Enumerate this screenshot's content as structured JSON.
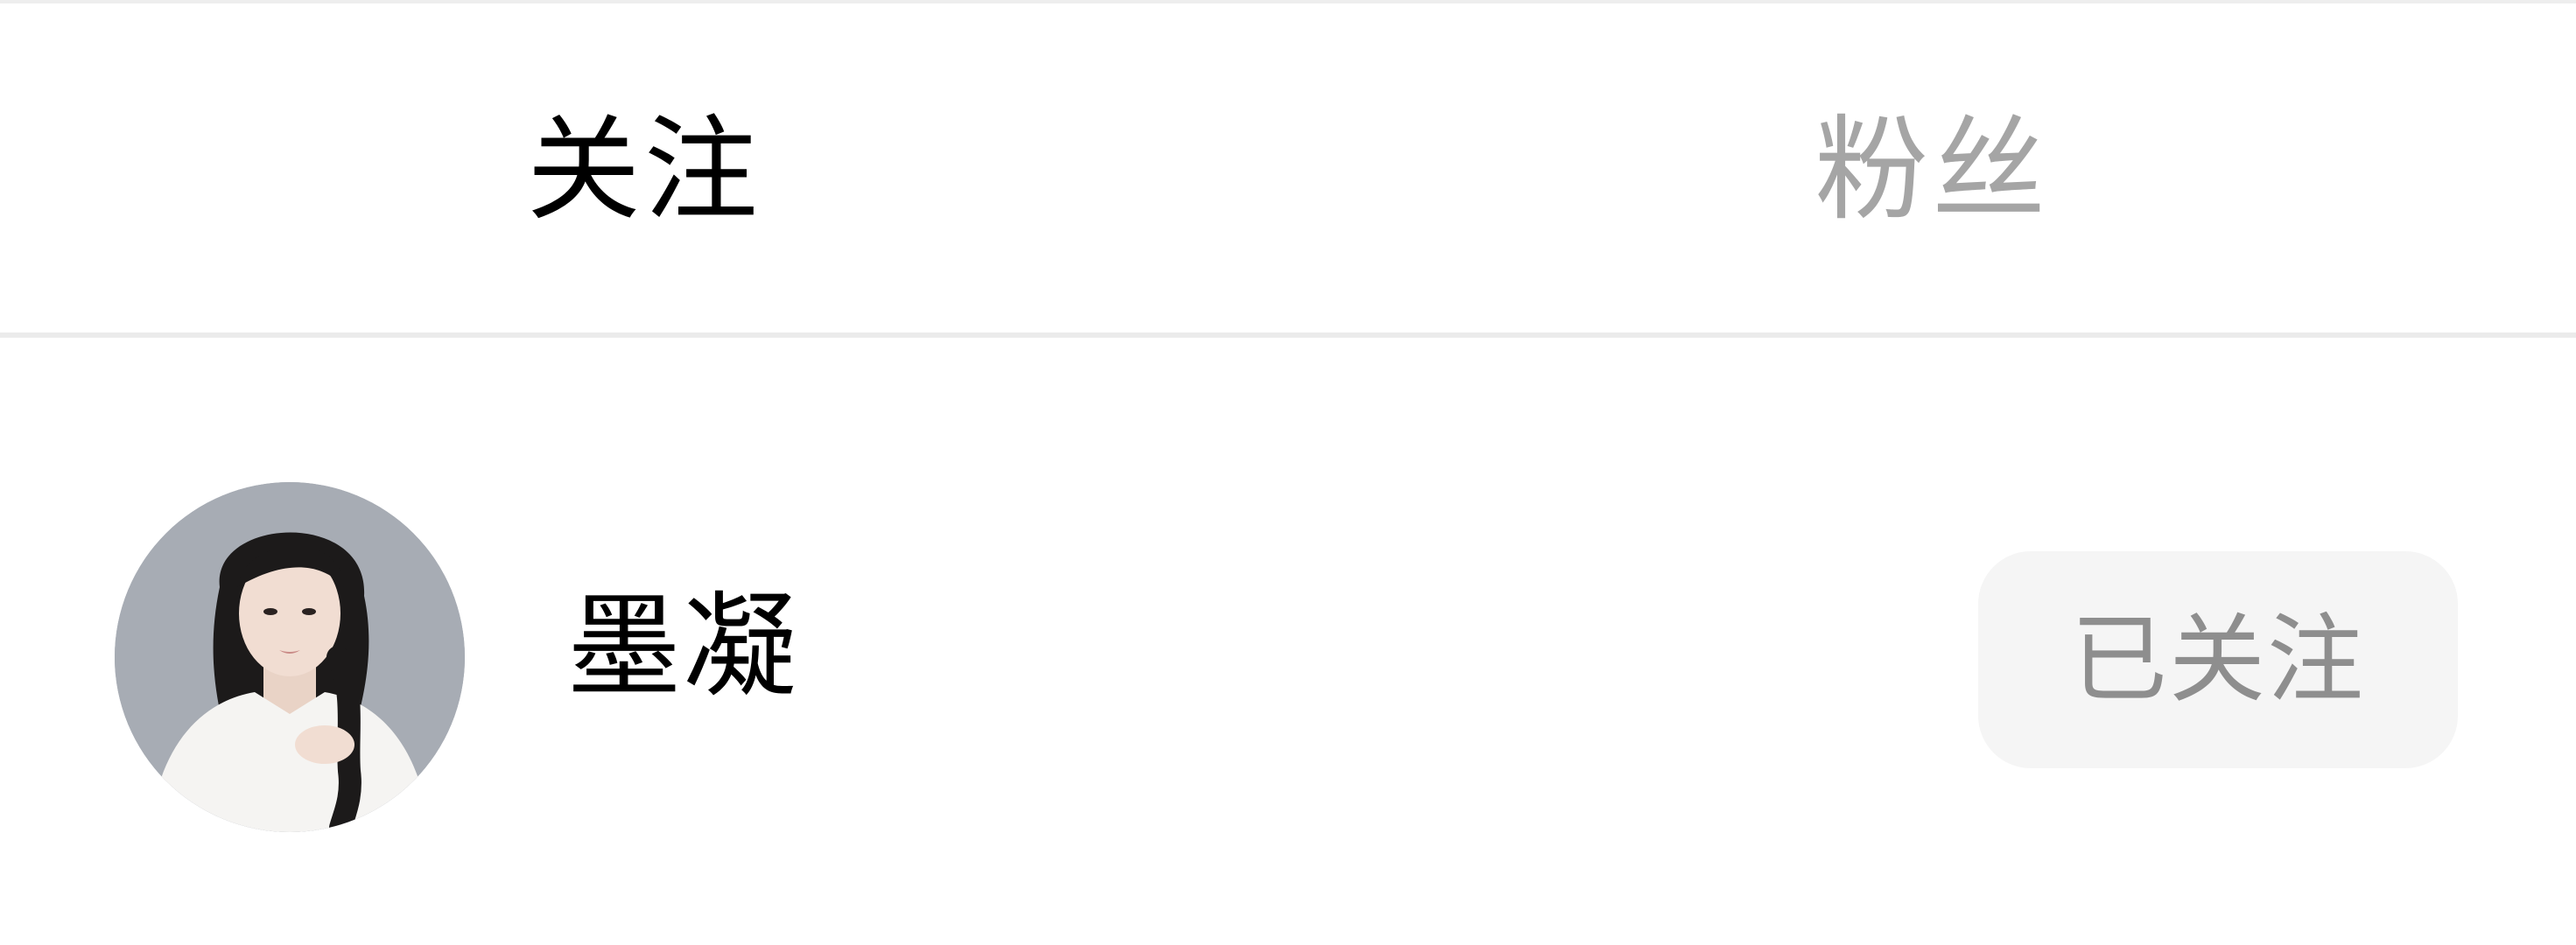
{
  "tabs": [
    {
      "label": "关注",
      "active": true
    },
    {
      "label": "粉丝",
      "active": false
    }
  ],
  "following_list": [
    {
      "name": "墨凝",
      "follow_status_label": "已关注"
    }
  ],
  "colors": {
    "active_tab_text": "#000000",
    "inactive_tab_text": "#a5a5a5",
    "divider": "#ebebeb",
    "follow_button_bg": "#f5f5f5",
    "follow_button_text": "#8e8e8e"
  }
}
